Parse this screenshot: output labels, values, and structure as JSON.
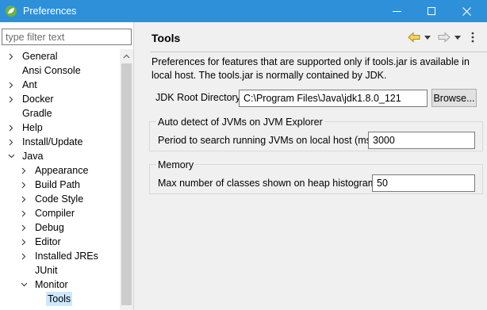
{
  "window": {
    "title": "Preferences",
    "accent_color": "#2e90d8",
    "icons": [
      "spring-leaf-icon",
      "minimize-icon",
      "maximize-icon",
      "close-icon"
    ]
  },
  "filter": {
    "placeholder": "type filter text",
    "value": ""
  },
  "tree": {
    "items": [
      {
        "label": "General",
        "level": 0,
        "expanded": false,
        "has_children": true
      },
      {
        "label": "Ansi Console",
        "level": 0,
        "has_children": false
      },
      {
        "label": "Ant",
        "level": 0,
        "expanded": false,
        "has_children": true
      },
      {
        "label": "Docker",
        "level": 0,
        "expanded": false,
        "has_children": true
      },
      {
        "label": "Gradle",
        "level": 0,
        "has_children": false
      },
      {
        "label": "Help",
        "level": 0,
        "expanded": false,
        "has_children": true
      },
      {
        "label": "Install/Update",
        "level": 0,
        "expanded": false,
        "has_children": true
      },
      {
        "label": "Java",
        "level": 0,
        "expanded": true,
        "has_children": true
      },
      {
        "label": "Appearance",
        "level": 1,
        "expanded": false,
        "has_children": true
      },
      {
        "label": "Build Path",
        "level": 1,
        "expanded": false,
        "has_children": true
      },
      {
        "label": "Code Style",
        "level": 1,
        "expanded": false,
        "has_children": true
      },
      {
        "label": "Compiler",
        "level": 1,
        "expanded": false,
        "has_children": true
      },
      {
        "label": "Debug",
        "level": 1,
        "expanded": false,
        "has_children": true
      },
      {
        "label": "Editor",
        "level": 1,
        "expanded": false,
        "has_children": true
      },
      {
        "label": "Installed JREs",
        "level": 1,
        "expanded": false,
        "has_children": true
      },
      {
        "label": "JUnit",
        "level": 1,
        "has_children": false
      },
      {
        "label": "Monitor",
        "level": 1,
        "expanded": true,
        "has_children": true
      },
      {
        "label": "Tools",
        "level": 2,
        "has_children": false,
        "selected": true
      }
    ]
  },
  "page": {
    "title": "Tools",
    "description": "Preferences for features that are supported only if tools.jar is available in local host. The tools.jar is normally contained by JDK.",
    "jdk_root": {
      "label": "JDK Root Directory:",
      "value": "C:\\Program Files\\Java\\jdk1.8.0_121",
      "browse_label": "Browse..."
    },
    "auto_detect": {
      "title": "Auto detect of JVMs on JVM Explorer",
      "period_label": "Period to search running JVMs on local host (ms):",
      "period_value": "3000"
    },
    "memory": {
      "title": "Memory",
      "max_classes_label": "Max number of classes shown on heap histogram:",
      "max_classes_value": "50"
    }
  }
}
